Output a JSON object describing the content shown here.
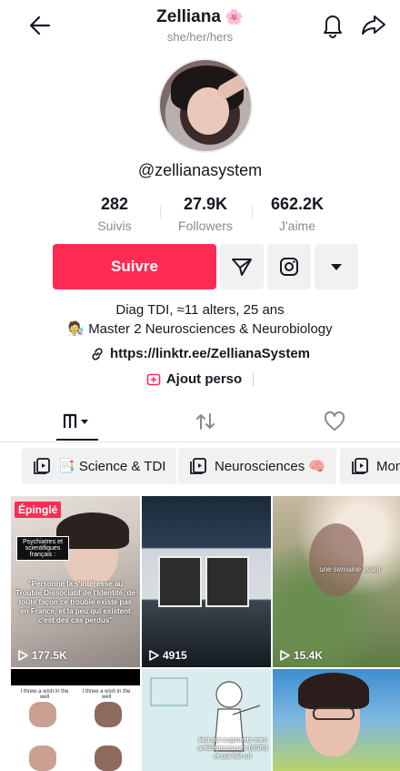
{
  "header": {
    "display_name": "Zelliana",
    "name_emoji": "🌸",
    "pronouns": "she/her/hers",
    "back_icon": "arrow-left-icon",
    "bell_icon": "bell-icon",
    "share_icon": "share-icon"
  },
  "profile": {
    "username": "@zellianasystem",
    "stats": [
      {
        "value": "282",
        "label": "Suivis"
      },
      {
        "value": "27.9K",
        "label": "Followers"
      },
      {
        "value": "662.2K",
        "label": "J'aime"
      }
    ]
  },
  "actions": {
    "follow_label": "Suivre",
    "message_icon": "send-icon",
    "instagram_icon": "instagram-icon",
    "more_icon": "caret-down-icon"
  },
  "bio": {
    "line1": "Diag TDI, ≈11 alters, 25 ans",
    "line2": "🧑‍🔬 Master 2 Neurosciences & Neurobiology",
    "link": "https://linktr.ee/ZellianaSystem",
    "addon_label": "Ajout perso"
  },
  "tabs": [
    {
      "icon": "grid-icon"
    },
    {
      "icon": "repost-icon"
    },
    {
      "icon": "heart-icon"
    }
  ],
  "playlists": [
    {
      "label": "📑 Science & TDI"
    },
    {
      "label": "Neurosciences 🧠"
    },
    {
      "label": "Mon"
    }
  ],
  "videos": [
    {
      "views": "177.5K",
      "pinned": "Épinglé",
      "caption_box": "Psychiatres et scientifiques français :",
      "caption": "\"Personne la s'intéresse au Trouble Dissociatif de l'Identité, de toute façon ce trouble existe pas en France, et la peu qui existent c'est des cas perdus\""
    },
    {
      "views": "4915"
    },
    {
      "views": "15.4K",
      "caption": "une semaine avant"
    },
    {
      "caption_top_left": "I threw a wish in the well",
      "caption_top_right": "I threw a wish in the well"
    },
    {
      "caption": "Moi qui augmente mes antidépresseurs (SSRI) et qui fait un"
    },
    {}
  ]
}
